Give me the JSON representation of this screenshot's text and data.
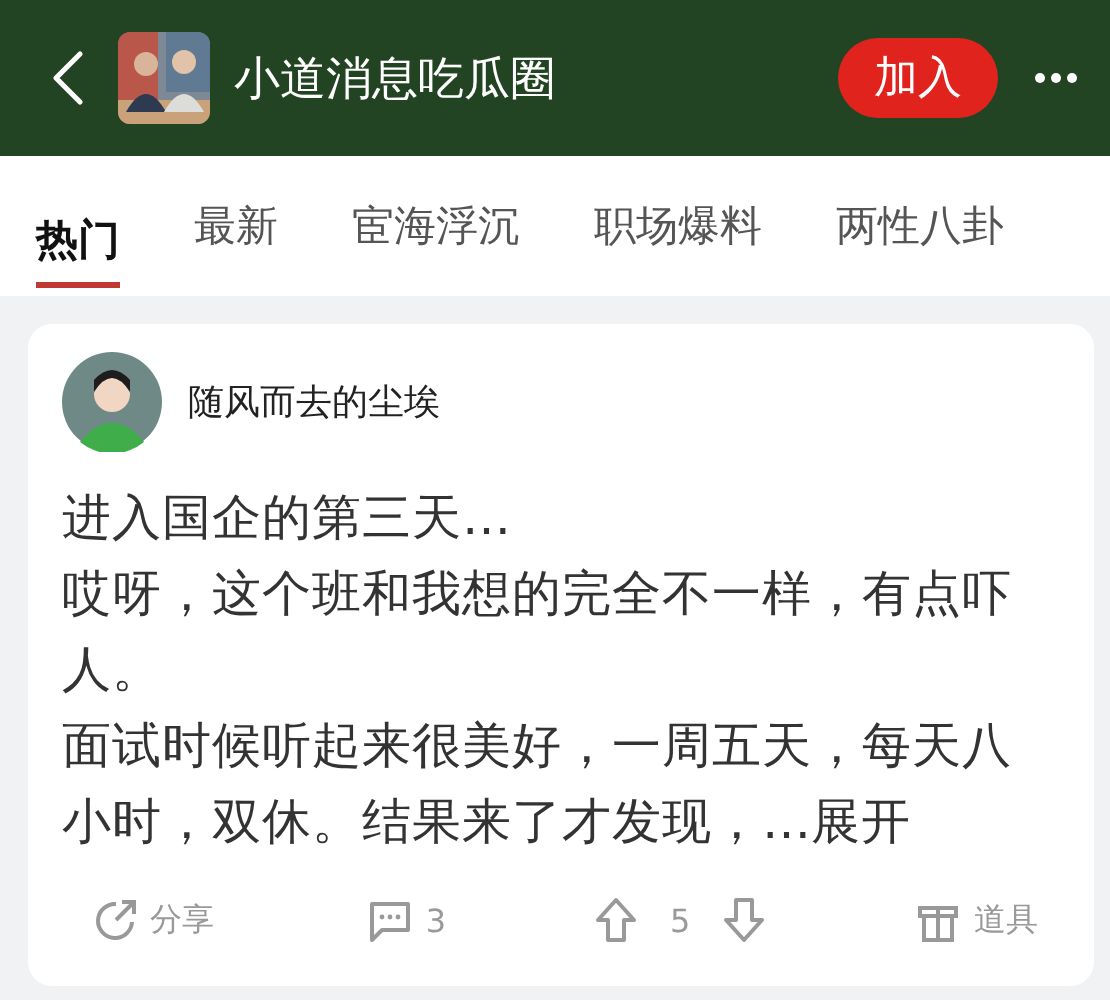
{
  "header": {
    "title": "小道消息吃瓜圈",
    "join_button": "加入"
  },
  "tabs": [
    {
      "label": "热门",
      "selected": true
    },
    {
      "label": "最新",
      "selected": false
    },
    {
      "label": "宦海浮沉",
      "selected": false
    },
    {
      "label": "职场爆料",
      "selected": false
    },
    {
      "label": "两性八卦",
      "selected": false
    }
  ],
  "post": {
    "author": "随风而去的尘埃",
    "paragraphs": [
      "进入国企的第三天…",
      "哎呀，这个班和我想的完全不一样，有点吓人。",
      "面试时候听起来很美好，一周五天，每天八小时，双休。结果来了才发现，…"
    ],
    "expand_link": "展开",
    "actions": [
      {
        "kind": "share",
        "label": "分享"
      },
      {
        "kind": "comment",
        "label": "3"
      },
      {
        "kind": "vote",
        "label": "5"
      },
      {
        "kind": "gift",
        "label": "道具"
      }
    ]
  }
}
